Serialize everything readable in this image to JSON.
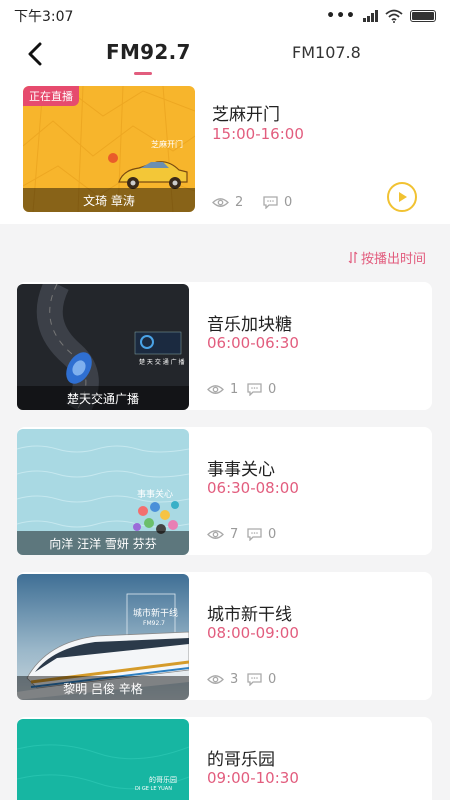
{
  "status_bar": {
    "time": "下午3:07",
    "dots": "•••"
  },
  "header": {
    "tabs": [
      "FM92.7",
      "FM107.8"
    ]
  },
  "live": {
    "badge": "正在直播",
    "caption": "文琦 章涛",
    "thumb_text": "芝麻开门",
    "title": "芝麻开门",
    "time": "15:00-16:00",
    "views": "2",
    "comments": "0"
  },
  "sort_label": "按播出时间",
  "programs": [
    {
      "title": "音乐加块糖",
      "time": "06:00-06:30",
      "caption": "楚天交通广播",
      "thumb_text": "楚 天 交 通 广 播",
      "views": "1",
      "comments": "0"
    },
    {
      "title": "事事关心",
      "time": "06:30-08:00",
      "caption": "向洋 汪洋 雪妍 芬芬",
      "thumb_text": "事事关心",
      "views": "7",
      "comments": "0"
    },
    {
      "title": "城市新干线",
      "time": "08:00-09:00",
      "caption": "黎明 吕俊 辛格",
      "thumb_text": "城市新干线",
      "thumb_sub": "FM92.7",
      "views": "3",
      "comments": "0"
    },
    {
      "title": "的哥乐园",
      "time": "09:00-10:30",
      "thumb_text": "的哥乐园",
      "thumb_sub": "DI GE LE YUAN"
    }
  ],
  "colors": {
    "accent": "#e25d7e",
    "play": "#f1c232",
    "live_bg": "#f7b52c"
  },
  "icons": [
    "back-arrow-icon",
    "eye-icon",
    "comment-icon",
    "play-icon",
    "sort-icon",
    "wifi-icon",
    "signal-icon",
    "battery-icon"
  ]
}
